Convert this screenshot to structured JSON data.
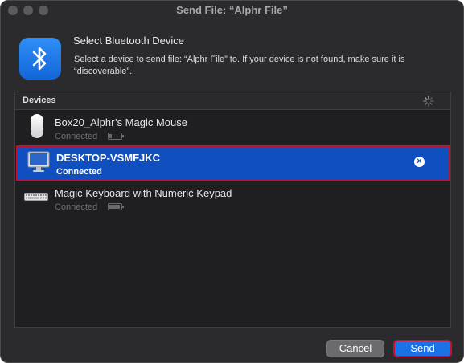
{
  "window": {
    "title": "Send File: “Alphr File”"
  },
  "header": {
    "title": "Select Bluetooth Device",
    "description": "Select a device to send file: “Alphr File” to. If your device is not found, make sure it is “discoverable”.",
    "icon": "bluetooth-icon"
  },
  "devices": {
    "label": "Devices",
    "items": [
      {
        "name": "Box20_Alphr’s Magic Mouse",
        "status": "Connected",
        "icon": "mouse-icon",
        "battery_level": 0.15
      },
      {
        "name": "DESKTOP-VSMFJKC",
        "status": "Connected",
        "icon": "monitor-icon",
        "selected": true
      },
      {
        "name": "Magic Keyboard with Numeric Keypad",
        "status": "Connected",
        "icon": "keyboard-icon",
        "battery_level": 0.85
      }
    ]
  },
  "buttons": {
    "cancel": "Cancel",
    "send": "Send"
  },
  "colors": {
    "selection": "#0f4fbf",
    "highlight_border": "#c8102e",
    "accent": "#1a72e6"
  }
}
